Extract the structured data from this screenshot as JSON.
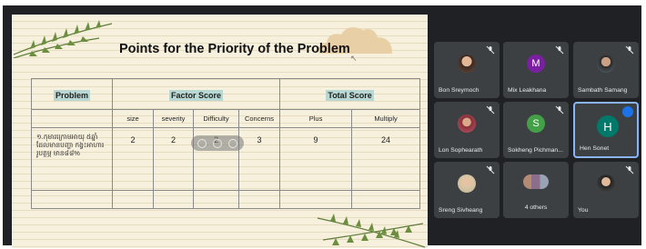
{
  "slide": {
    "title": "Points for the Priority of the Problem",
    "table": {
      "headers": {
        "problem": "Problem",
        "factor_score": "Factor Score",
        "total_score": "Total Score"
      },
      "subheaders": [
        "size",
        "severity",
        "Difficulty",
        "Concerns",
        "Plus",
        "Multiply"
      ],
      "row": {
        "problem_text": "១.កុមារក្រោមអាយុ ៥ឆ្នាំដែលមានបញ្ហា កង្វះអាហាររូបត្ថម្ភ មាន៨៨%",
        "values": [
          "2",
          "2",
          "2",
          "3",
          "9",
          "24"
        ]
      }
    }
  },
  "participants": [
    {
      "name": "Bon Sreymoch",
      "avatar": "photo",
      "muted": true
    },
    {
      "name": "Mix Leakhana",
      "avatar": "M",
      "avatar_color": "#7b1fa2",
      "muted": true
    },
    {
      "name": "Sambath Samang",
      "avatar": "photo",
      "muted": true
    },
    {
      "name": "Lon Sophearath",
      "avatar": "photo",
      "muted": true
    },
    {
      "name": "Sokheng Pichman...",
      "avatar": "S",
      "avatar_color": "#43a047",
      "muted": true
    },
    {
      "name": "Hen Sonet",
      "avatar": "H",
      "avatar_color": "#00796b",
      "speaking": true
    },
    {
      "name": "Sreng Sivheang",
      "avatar": "photo",
      "muted": true
    },
    {
      "name": "4 others",
      "avatar": "group"
    },
    {
      "name": "You",
      "avatar": "photo",
      "muted": true
    }
  ],
  "colors": {
    "background": "#202124",
    "tile": "#3c4043",
    "active_border": "#8ab4f8",
    "header_highlight": "#b9d7d3"
  }
}
